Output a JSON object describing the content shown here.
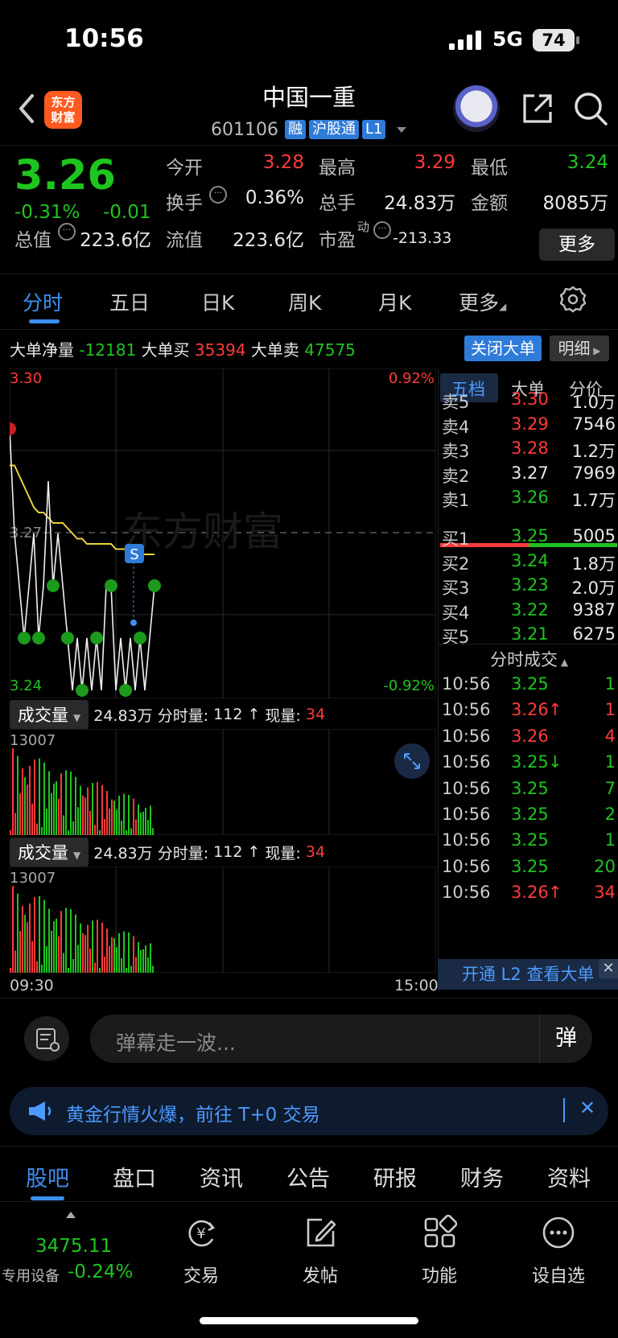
{
  "status": {
    "time": "10:56",
    "network": "5G",
    "battery": "74"
  },
  "header": {
    "logo": "东方财富",
    "stock_name": "中国一重",
    "stock_code": "601106",
    "tags": [
      "融",
      "沪股通",
      "L1"
    ]
  },
  "quote": {
    "price": "3.26",
    "change_pct": "-0.31%",
    "change_abs": "-0.01",
    "fields": {
      "open_label": "今开",
      "open": "3.28",
      "high_label": "最高",
      "high": "3.29",
      "low_label": "最低",
      "low": "3.24",
      "turnover_label": "换手",
      "turnover": "0.36%",
      "volume_label": "总手",
      "volume": "24.83万",
      "amount_label": "金额",
      "amount": "8085万",
      "mktcap_label": "总值",
      "mktcap": "223.6亿",
      "float_label": "流值",
      "float_cap": "223.6亿",
      "pe_label": "市盈",
      "pe_sup": "动",
      "pe": "-213.33"
    },
    "more": "更多"
  },
  "chart_tabs": [
    "分时",
    "五日",
    "日K",
    "周K",
    "月K",
    "更多"
  ],
  "big_orders": {
    "net_label": "大单净量",
    "net": "-12181",
    "buy_label": "大单买",
    "buy": "35394",
    "sell_label": "大单卖",
    "sell": "47575",
    "close_btn": "关闭大单",
    "detail_btn": "明细"
  },
  "chart": {
    "y_high": "3.30",
    "y_high_pct": "0.92%",
    "y_mid": "3.27",
    "y_low": "3.24",
    "y_low_pct": "-0.92%",
    "watermark": "东方财富",
    "marker": "S",
    "x_start": "09:30",
    "x_end": "15:00"
  },
  "chart_data": {
    "type": "line",
    "title": "",
    "ylim": [
      3.24,
      3.3
    ],
    "yticks": [
      "3.30",
      "3.27",
      "3.24"
    ],
    "xticks": [
      "09:30",
      "15:00"
    ],
    "series": [
      {
        "values": [
          3.283,
          3.283,
          3.281,
          3.279,
          3.277,
          3.275,
          3.274,
          3.274,
          3.273,
          3.272,
          3.272,
          3.272,
          3.271,
          3.27,
          3.269,
          3.269,
          3.268,
          3.268,
          3.268,
          3.268,
          3.268,
          3.268,
          3.267,
          3.267,
          3.267,
          3.266,
          3.266,
          3.266,
          3.266,
          3.266,
          3.266
        ]
      },
      {
        "values": [
          3.29,
          3.27,
          3.26,
          3.25,
          3.26,
          3.27,
          3.25,
          3.26,
          3.28,
          3.26,
          3.27,
          3.26,
          3.25,
          3.24,
          3.25,
          3.24,
          3.25,
          3.24,
          3.25,
          3.24,
          3.26,
          3.26,
          3.24,
          3.25,
          3.24,
          3.25,
          3.24,
          3.25,
          3.24,
          3.25,
          3.26
        ]
      }
    ]
  },
  "volume_panels": [
    {
      "label": "成交量",
      "total": "24.83万",
      "period_label": "分时量:",
      "period": "112",
      "arrow": "↑",
      "now_label": "现量:",
      "now": "34",
      "max": "13007"
    },
    {
      "label": "成交量",
      "total": "24.83万",
      "period_label": "分时量:",
      "period": "112",
      "arrow": "↑",
      "now_label": "现量:",
      "now": "34",
      "max": "13007"
    }
  ],
  "order_book": {
    "tabs": [
      "五档",
      "大单",
      "分价"
    ],
    "asks": [
      {
        "label": "卖5",
        "price": "3.30",
        "vol": "1.0万",
        "color": "#ff3b3b"
      },
      {
        "label": "卖4",
        "price": "3.29",
        "vol": "7546",
        "color": "#ff3b3b"
      },
      {
        "label": "卖3",
        "price": "3.28",
        "vol": "1.2万",
        "color": "#ff3b3b"
      },
      {
        "label": "卖2",
        "price": "3.27",
        "vol": "7969",
        "color": "#e8e8e8"
      },
      {
        "label": "卖1",
        "price": "3.26",
        "vol": "1.7万",
        "color": "#1fc51f"
      }
    ],
    "bids": [
      {
        "label": "买1",
        "price": "3.25",
        "vol": "5005",
        "color": "#1fc51f"
      },
      {
        "label": "买2",
        "price": "3.24",
        "vol": "1.8万",
        "color": "#1fc51f"
      },
      {
        "label": "买3",
        "price": "3.23",
        "vol": "2.0万",
        "color": "#1fc51f"
      },
      {
        "label": "买4",
        "price": "3.22",
        "vol": "9387",
        "color": "#1fc51f"
      },
      {
        "label": "买5",
        "price": "3.21",
        "vol": "6275",
        "color": "#1fc51f"
      }
    ]
  },
  "trades": {
    "title": "分时成交",
    "rows": [
      {
        "time": "10:56",
        "price": "3.25",
        "arrow": "",
        "vol": "1",
        "vcolor": "#1fc51f"
      },
      {
        "time": "10:56",
        "price": "3.26",
        "arrow": "↑",
        "vol": "1",
        "vcolor": "#ff3b3b"
      },
      {
        "time": "10:56",
        "price": "3.26",
        "arrow": "",
        "vol": "4",
        "vcolor": "#ff3b3b"
      },
      {
        "time": "10:56",
        "price": "3.25",
        "arrow": "↓",
        "vol": "1",
        "vcolor": "#1fc51f"
      },
      {
        "time": "10:56",
        "price": "3.25",
        "arrow": "",
        "vol": "7",
        "vcolor": "#1fc51f"
      },
      {
        "time": "10:56",
        "price": "3.25",
        "arrow": "",
        "vol": "2",
        "vcolor": "#1fc51f"
      },
      {
        "time": "10:56",
        "price": "3.25",
        "arrow": "",
        "vol": "1",
        "vcolor": "#1fc51f"
      },
      {
        "time": "10:56",
        "price": "3.25",
        "arrow": "",
        "vol": "20",
        "vcolor": "#1fc51f"
      },
      {
        "time": "10:56",
        "price": "3.26",
        "arrow": "↑",
        "vol": "34",
        "vcolor": "#ff3b3b"
      }
    ],
    "l2_banner": "开通 L2 查看大单"
  },
  "comment": {
    "placeholder": "弹幕走一波...",
    "button": "弹"
  },
  "promo": {
    "text": "黄金行情火爆，前往 T+0 交易"
  },
  "bottom_tabs": [
    "股吧",
    "盘口",
    "资讯",
    "公告",
    "研报",
    "财务",
    "资料"
  ],
  "toolbar": {
    "index_value": "3475.11",
    "index_label": "专用设备",
    "index_change": "-0.24%",
    "items": [
      {
        "label": "交易",
        "icon": "yuan-exchange-icon"
      },
      {
        "label": "发帖",
        "icon": "edit-icon"
      },
      {
        "label": "功能",
        "icon": "grid-icon"
      },
      {
        "label": "设自选",
        "icon": "more-circle-icon"
      }
    ]
  },
  "colors": {
    "up": "#ff3b3b",
    "down": "#1fc51f",
    "accent": "#3c8ff0",
    "avg_line": "#e8d33c"
  }
}
